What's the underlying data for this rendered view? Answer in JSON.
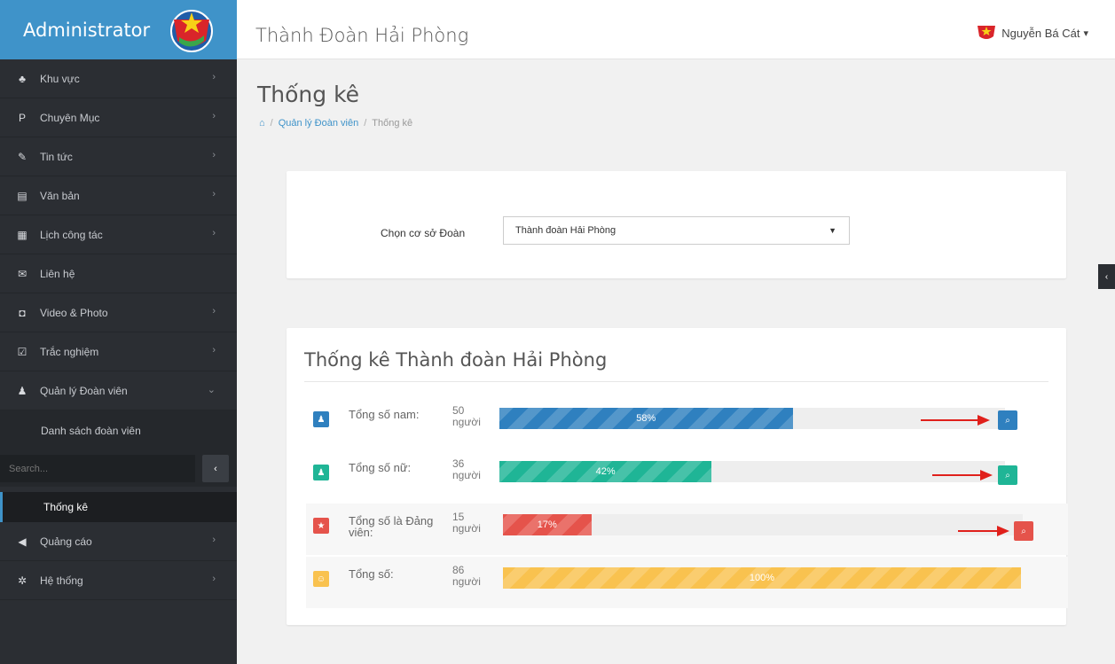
{
  "app": {
    "brand_title": "Administrator",
    "site_title": "Thành Đoàn Hải Phòng"
  },
  "user": {
    "name": "Nguyễn Bá Cát",
    "caret": "▾"
  },
  "sidebar": {
    "items": [
      {
        "label": "Khu vực",
        "icon": "sitemap-icon",
        "glyph": "♣",
        "chev": "›"
      },
      {
        "label": "Chuyên Mục",
        "icon": "paragraph-icon",
        "glyph": "P",
        "chev": "›"
      },
      {
        "label": "Tin tức",
        "icon": "pencil-icon",
        "glyph": "✎",
        "chev": "›"
      },
      {
        "label": "Văn bản",
        "icon": "file-icon",
        "glyph": "▤",
        "chev": "›"
      },
      {
        "label": "Lịch công tác",
        "icon": "calendar-icon",
        "glyph": "▦",
        "chev": "›"
      },
      {
        "label": "Liên hệ",
        "icon": "envelope-icon",
        "glyph": "✉",
        "chev": ""
      },
      {
        "label": "Video & Photo",
        "icon": "camera-icon",
        "glyph": "◘",
        "chev": "›"
      },
      {
        "label": "Trắc nghiệm",
        "icon": "check-square-icon",
        "glyph": "☑",
        "chev": "›"
      },
      {
        "label": "Quản lý Đoàn viên",
        "icon": "user-icon",
        "glyph": "♟",
        "chev": "⌄"
      }
    ],
    "submenu": {
      "list_label": "Danh sách đoàn viên",
      "active_label": "Thống kê"
    },
    "search": {
      "placeholder": "Search...",
      "button": "‹"
    },
    "bottom_items": [
      {
        "label": "Quảng cáo",
        "icon": "bullhorn-icon",
        "glyph": "◀",
        "chev": "›"
      },
      {
        "label": "Hệ thống",
        "icon": "cog-icon",
        "glyph": "✲",
        "chev": "›"
      }
    ]
  },
  "page": {
    "title": "Thống kê",
    "breadcrumb": {
      "home_glyph": "⌂",
      "link": "Quản lý Đoàn viên",
      "sep": "/",
      "current": "Thống kê"
    }
  },
  "filter": {
    "label": "Chọn cơ sở Đoàn",
    "selected": "Thành đoàn Hải Phòng",
    "caret": "▼"
  },
  "stats": {
    "title": "Thống kê Thành đoàn Hải Phòng",
    "rows": [
      {
        "label": "Tổng số nam:",
        "count": "50",
        "unit": "người",
        "percent_text": "58%",
        "percent": 58,
        "color": "#2f80bf",
        "icon_glyph": "♟",
        "search_glyph": "⌕"
      },
      {
        "label": "Tổng số nữ:",
        "count": "36",
        "unit": "người",
        "percent_text": "42%",
        "percent": 42,
        "color": "#1fb596",
        "icon_glyph": "♟",
        "search_glyph": "⌕"
      },
      {
        "label": "Tổng số là Đảng viên:",
        "count": "15",
        "unit": "người",
        "percent_text": "17%",
        "percent": 17,
        "color": "#e5534b",
        "icon_glyph": "★",
        "search_glyph": "⌕"
      },
      {
        "label": "Tổng số:",
        "count": "86",
        "unit": "người",
        "percent_text": "100%",
        "percent": 100,
        "color": "#f9c24f",
        "icon_glyph": "☺",
        "search_glyph": ""
      }
    ]
  },
  "colors": {
    "brand": "#3f93c9",
    "sidebar": "#2b2e33",
    "arrow": "#e0201b"
  },
  "right_toggle": "‹"
}
